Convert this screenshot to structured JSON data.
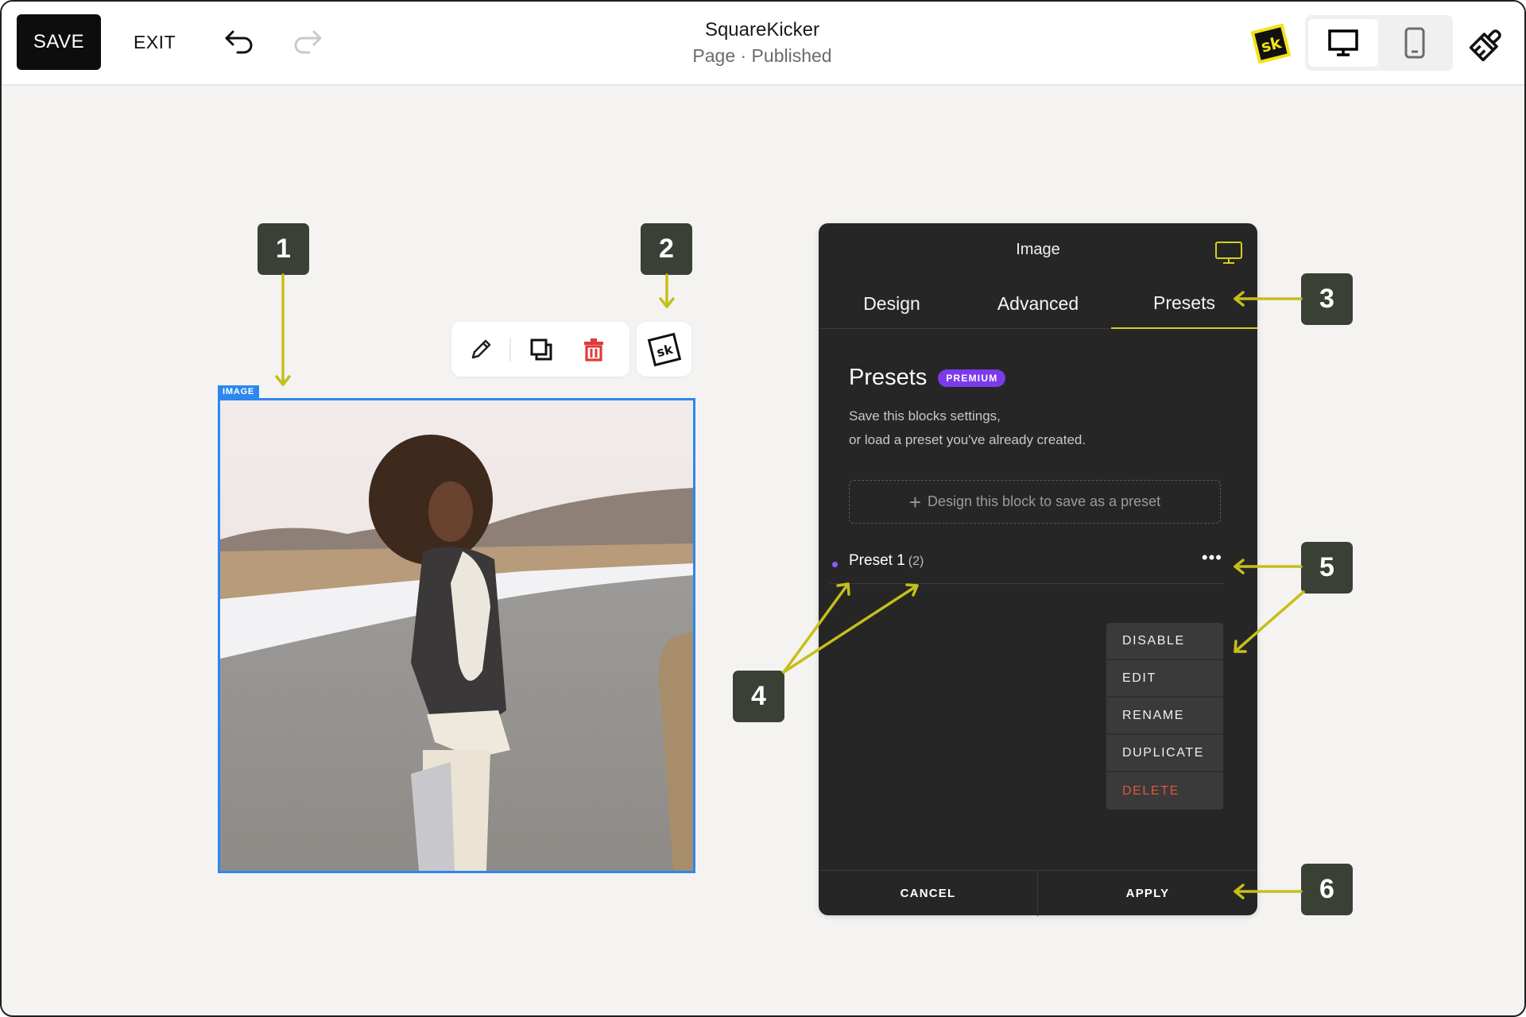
{
  "topbar": {
    "save_label": "SAVE",
    "exit_label": "EXIT",
    "undo_icon": "undo-icon",
    "redo_icon": "redo-icon",
    "app_title": "SquareKicker",
    "page_status": "Page · Published",
    "logo_text": "sk",
    "device_options": [
      {
        "name": "desktop",
        "icon": "desktop-icon",
        "selected": true
      },
      {
        "name": "mobile",
        "icon": "mobile-icon",
        "selected": false
      }
    ],
    "brush_icon": "paintbrush-icon"
  },
  "canvas": {
    "image_tag": "IMAGE",
    "toolbar": {
      "edit_icon": "pencil-icon",
      "duplicate_icon": "duplicate-icon",
      "delete_icon": "trash-icon",
      "sk_text": "sk"
    }
  },
  "panel": {
    "title": "Image",
    "tabs": [
      {
        "label": "Design",
        "active": false
      },
      {
        "label": "Advanced",
        "active": false
      },
      {
        "label": "Presets",
        "active": true
      }
    ],
    "heading": "Presets",
    "badge": "PREMIUM",
    "description_line1": "Save this blocks settings,",
    "description_line2": "or load a preset you've already created.",
    "add_preset_label": "Design this block to save as a preset",
    "presets": [
      {
        "name": "Preset 1",
        "count": "(2)"
      }
    ],
    "more_label": "•••",
    "menu_items": [
      {
        "label": "DISABLE",
        "danger": false
      },
      {
        "label": "EDIT",
        "danger": false
      },
      {
        "label": "RENAME",
        "danger": false
      },
      {
        "label": "DUPLICATE",
        "danger": false
      },
      {
        "label": "DELETE",
        "danger": true
      }
    ],
    "cancel_label": "CANCEL",
    "apply_label": "APPLY"
  },
  "annotations": {
    "markers": [
      "1",
      "2",
      "3",
      "4",
      "5",
      "6"
    ],
    "arrow_color": "#c5bf1a",
    "marker_color": "#3b4036"
  },
  "colors": {
    "accent_blue": "#2d87f0",
    "premium_purple": "#7c3aed",
    "panel_bg": "#262626",
    "tab_underline": "#d6cf1e",
    "danger": "#e0553a"
  }
}
